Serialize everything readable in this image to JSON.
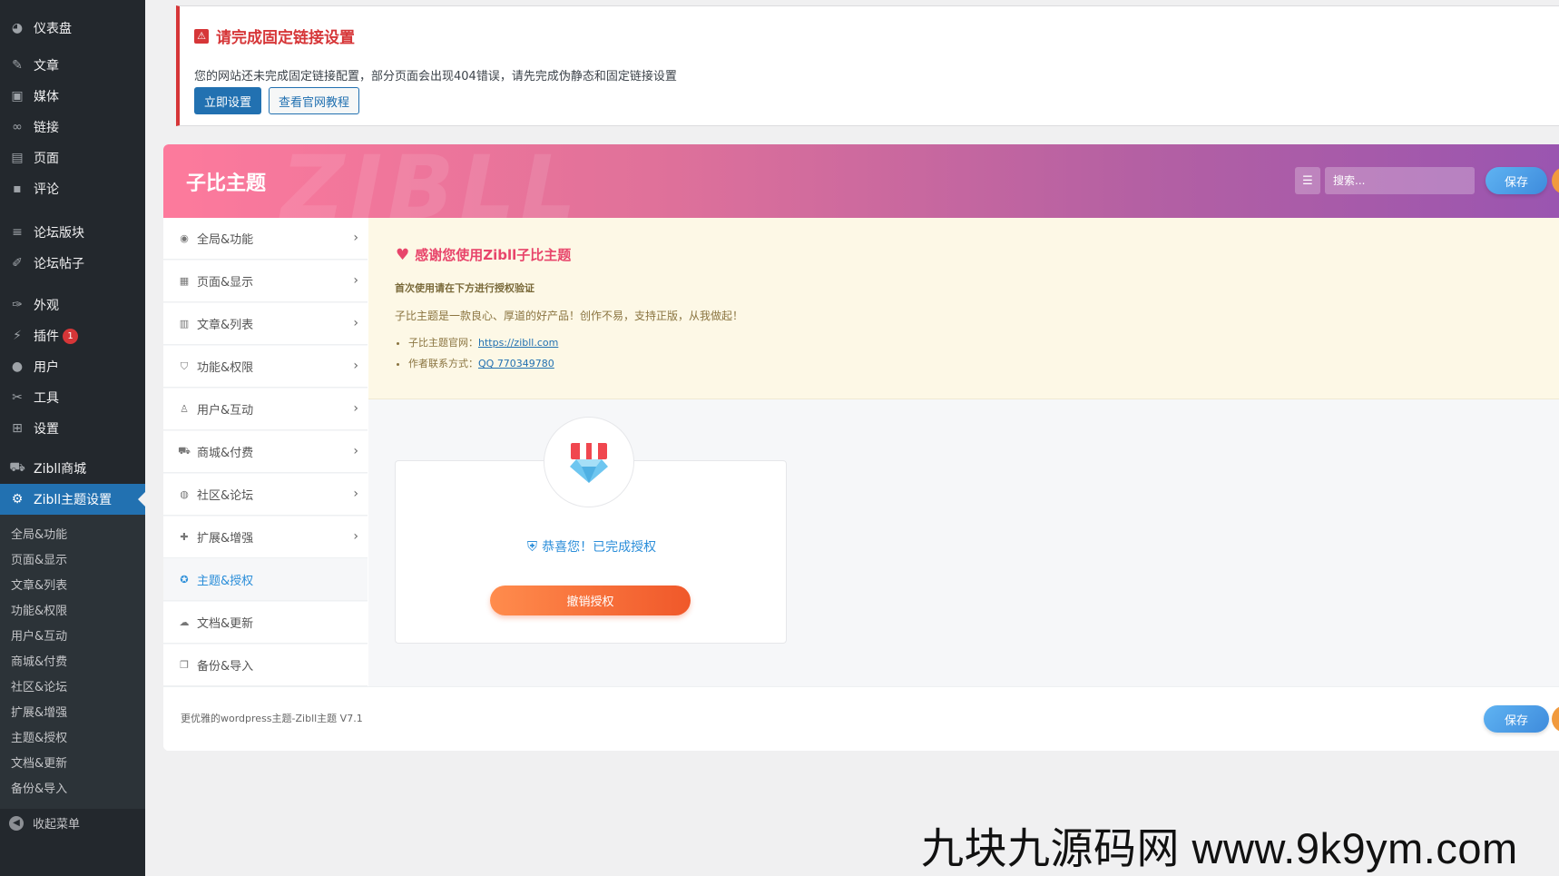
{
  "sidebar": {
    "items": [
      {
        "label": "仪表盘",
        "icon": "dashboard-icon"
      },
      {
        "label": "文章",
        "icon": "pin-icon"
      },
      {
        "label": "媒体",
        "icon": "media-icon"
      },
      {
        "label": "链接",
        "icon": "link-icon"
      },
      {
        "label": "页面",
        "icon": "page-icon"
      },
      {
        "label": "评论",
        "icon": "comment-icon"
      },
      {
        "label": "论坛版块",
        "icon": "forum-icon"
      },
      {
        "label": "论坛帖子",
        "icon": "post-icon"
      },
      {
        "label": "外观",
        "icon": "brush-icon"
      },
      {
        "label": "插件",
        "icon": "plugin-icon",
        "badge": "1"
      },
      {
        "label": "用户",
        "icon": "user-icon"
      },
      {
        "label": "工具",
        "icon": "wrench-icon"
      },
      {
        "label": "设置",
        "icon": "settings-icon"
      },
      {
        "label": "Zibll商城",
        "icon": "cart-icon"
      },
      {
        "label": "Zibll主题设置",
        "icon": "gear-icon",
        "active": true
      }
    ],
    "submenu": [
      "全局&功能",
      "页面&显示",
      "文章&列表",
      "功能&权限",
      "用户&互动",
      "商城&付费",
      "社区&论坛",
      "扩展&增强",
      "主题&授权",
      "文档&更新",
      "备份&导入"
    ],
    "collapse_label": "收起菜单"
  },
  "notice": {
    "title": "请完成固定链接设置",
    "text": "您的网站还未完成固定链接配置，部分页面会出现404错误，请先完成伪静态和固定链接设置",
    "primary_button": "立即设置",
    "secondary_button": "查看官网教程"
  },
  "panel": {
    "title": "子比主题",
    "watermark": "ZIBLL",
    "search_placeholder": "搜索...",
    "save_label": "保存",
    "nav": [
      {
        "label": "全局&功能",
        "icon": "target-icon"
      },
      {
        "label": "页面&显示",
        "icon": "calendar-icon"
      },
      {
        "label": "文章&列表",
        "icon": "map-icon"
      },
      {
        "label": "功能&权限",
        "icon": "shield-icon"
      },
      {
        "label": "用户&互动",
        "icon": "user-icon"
      },
      {
        "label": "商城&付费",
        "icon": "cart-icon"
      },
      {
        "label": "社区&论坛",
        "icon": "compass-icon"
      },
      {
        "label": "扩展&增强",
        "icon": "puzzle-icon"
      },
      {
        "label": "主题&授权",
        "icon": "badge-icon",
        "active": true
      },
      {
        "label": "文档&更新",
        "icon": "cloud-icon"
      },
      {
        "label": "备份&导入",
        "icon": "copy-icon"
      }
    ],
    "welcome": {
      "title": "感谢您使用Zibll子比主题",
      "subtitle": "首次使用请在下方进行授权验证",
      "description": "子比主题是一款良心、厚道的好产品！创作不易，支持正版，从我做起！",
      "links": [
        {
          "label": "子比主题官网：",
          "link": "https://zibll.com"
        },
        {
          "label": "作者联系方式：",
          "link": "QQ 770349780"
        }
      ]
    },
    "license": {
      "status": "恭喜您！已完成授权",
      "revoke_button": "撤销授权"
    },
    "footer_text": "更优雅的wordpress主题-Zibll主题 V7.1"
  },
  "watermark_text": "九块九源码网 www.9k9ym.com",
  "colors": {
    "admin_bg": "#23282d",
    "active_blue": "#2271b1",
    "header_gradient_start": "#fd7a9c",
    "header_gradient_end": "#9a55b0",
    "revoke_orange": "#f0582a",
    "notice_red": "#d63638"
  }
}
